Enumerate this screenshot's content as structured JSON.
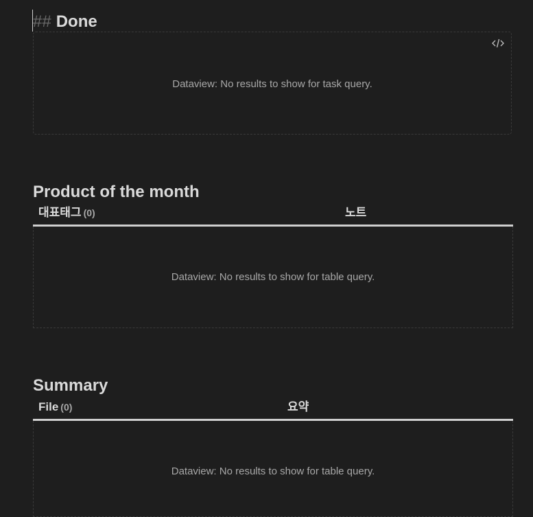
{
  "done_section": {
    "marker": "##",
    "title": "Done",
    "message": "Dataview: No results to show for task query."
  },
  "product_section": {
    "title": "Product of the month",
    "columns": [
      {
        "label": "대표태그",
        "count": "(0)"
      },
      {
        "label": "노트"
      }
    ],
    "message": "Dataview: No results to show for table query."
  },
  "summary_section": {
    "title": "Summary",
    "columns": [
      {
        "label": "File",
        "count": "(0)"
      },
      {
        "label": "요약"
      }
    ],
    "message": "Dataview: No results to show for table query."
  },
  "icons": {
    "code_toggle": "code-icon"
  },
  "colors": {
    "background": "#1e1e1e",
    "text": "#dadada",
    "muted": "#a8a8a8",
    "rule": "#cfcfcf"
  }
}
